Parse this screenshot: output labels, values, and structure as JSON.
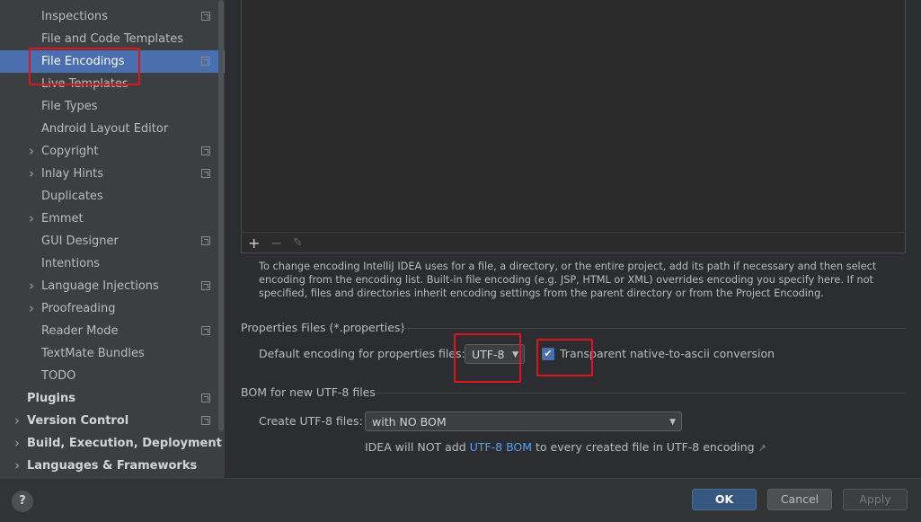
{
  "sidebar": {
    "items": [
      {
        "label": "Inspections",
        "indent": 2,
        "expandable": false,
        "project": true,
        "selected": false,
        "bold": false
      },
      {
        "label": "File and Code Templates",
        "indent": 2,
        "expandable": false,
        "project": false,
        "selected": false,
        "bold": false
      },
      {
        "label": "File Encodings",
        "indent": 2,
        "expandable": false,
        "project": true,
        "selected": true,
        "bold": false
      },
      {
        "label": "Live Templates",
        "indent": 2,
        "expandable": false,
        "project": false,
        "selected": false,
        "bold": false
      },
      {
        "label": "File Types",
        "indent": 2,
        "expandable": false,
        "project": false,
        "selected": false,
        "bold": false
      },
      {
        "label": "Android Layout Editor",
        "indent": 2,
        "expandable": false,
        "project": false,
        "selected": false,
        "bold": false
      },
      {
        "label": "Copyright",
        "indent": 2,
        "expandable": true,
        "project": true,
        "selected": false,
        "bold": false
      },
      {
        "label": "Inlay Hints",
        "indent": 2,
        "expandable": true,
        "project": true,
        "selected": false,
        "bold": false
      },
      {
        "label": "Duplicates",
        "indent": 2,
        "expandable": false,
        "project": false,
        "selected": false,
        "bold": false
      },
      {
        "label": "Emmet",
        "indent": 2,
        "expandable": true,
        "project": false,
        "selected": false,
        "bold": false
      },
      {
        "label": "GUI Designer",
        "indent": 2,
        "expandable": false,
        "project": true,
        "selected": false,
        "bold": false
      },
      {
        "label": "Intentions",
        "indent": 2,
        "expandable": false,
        "project": false,
        "selected": false,
        "bold": false
      },
      {
        "label": "Language Injections",
        "indent": 2,
        "expandable": true,
        "project": true,
        "selected": false,
        "bold": false
      },
      {
        "label": "Proofreading",
        "indent": 2,
        "expandable": true,
        "project": false,
        "selected": false,
        "bold": false
      },
      {
        "label": "Reader Mode",
        "indent": 2,
        "expandable": false,
        "project": true,
        "selected": false,
        "bold": false
      },
      {
        "label": "TextMate Bundles",
        "indent": 2,
        "expandable": false,
        "project": false,
        "selected": false,
        "bold": false
      },
      {
        "label": "TODO",
        "indent": 2,
        "expandable": false,
        "project": false,
        "selected": false,
        "bold": false
      },
      {
        "label": "Plugins",
        "indent": 1,
        "expandable": false,
        "project": true,
        "selected": false,
        "bold": true
      },
      {
        "label": "Version Control",
        "indent": 1,
        "expandable": true,
        "project": true,
        "selected": false,
        "bold": true
      },
      {
        "label": "Build, Execution, Deployment",
        "indent": 1,
        "expandable": true,
        "project": false,
        "selected": false,
        "bold": true
      },
      {
        "label": "Languages & Frameworks",
        "indent": 1,
        "expandable": true,
        "project": false,
        "selected": false,
        "bold": true
      }
    ]
  },
  "main": {
    "toolbar": {
      "add": "+",
      "remove": "−",
      "edit": "✎"
    },
    "help_text": "To change encoding IntelliJ IDEA uses for a file, a directory, or the entire project, add its path if necessary and then select encoding from the encoding list. Built-in file encoding (e.g. JSP, HTML or XML) overrides encoding you specify here. If not specified, files and directories inherit encoding settings from the parent directory or from the Project Encoding.",
    "properties_section": "Properties Files (*.properties)",
    "default_encoding_label": "Default encoding for properties files:",
    "default_encoding_value": "UTF-8",
    "native_ascii_label": "Transparent native-to-ascii conversion",
    "native_ascii_checked": true,
    "bom_section": "BOM for new UTF-8 files",
    "create_utf8_label": "Create UTF-8 files:",
    "create_utf8_value": "with NO BOM",
    "bom_note_prefix": "IDEA will NOT add ",
    "bom_note_link": "UTF-8 BOM",
    "bom_note_suffix": " to every created file in UTF-8 encoding",
    "bom_note_arrow": "↗"
  },
  "footer": {
    "help": "?",
    "ok": "OK",
    "cancel": "Cancel",
    "apply": "Apply"
  },
  "colors": {
    "selection": "#4b6eaf",
    "highlight_annotation": "#e1141e",
    "link": "#589df6"
  }
}
